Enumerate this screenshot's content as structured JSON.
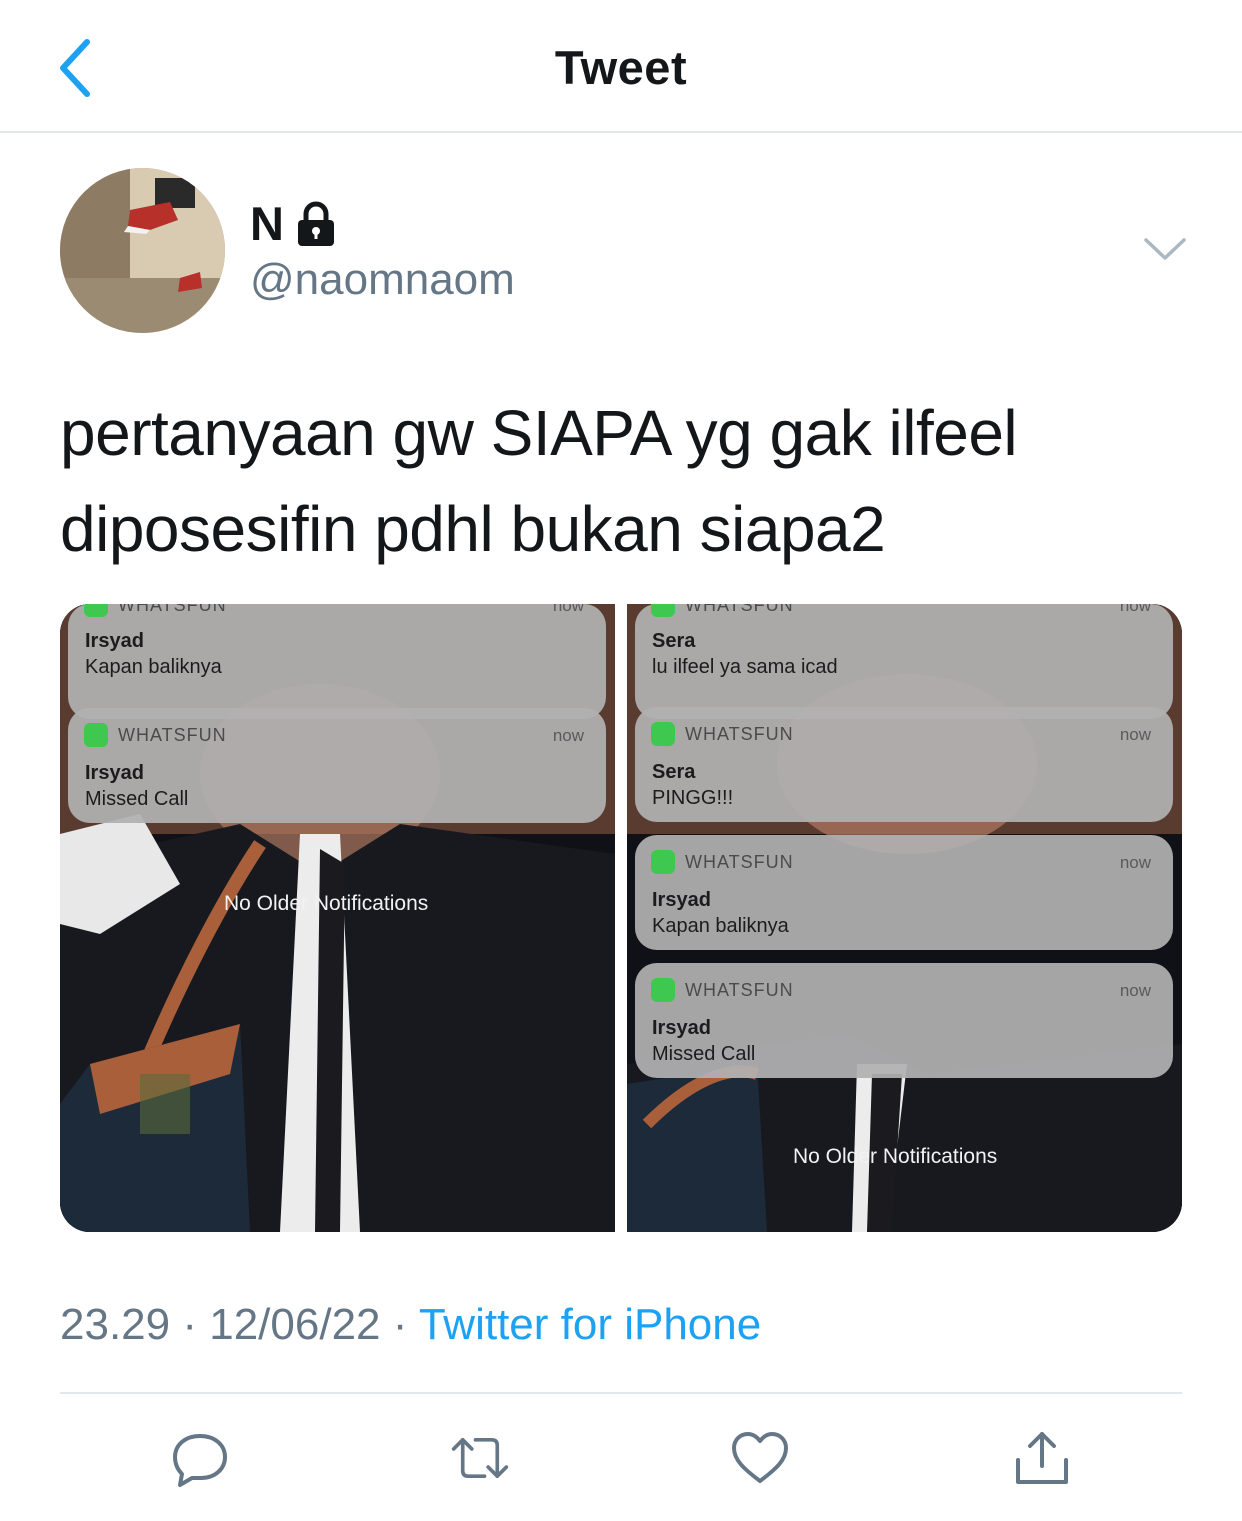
{
  "header": {
    "title": "Tweet"
  },
  "author": {
    "name": "N",
    "handle": "@naomnaom"
  },
  "tweet": {
    "text": "pertanyaan gw SIAPA yg gak ilfeel diposesifin pdhl bukan siapa2"
  },
  "media": {
    "left": {
      "notifications": [
        {
          "app": "WHATSFUN",
          "time": "now",
          "sender": "Irsyad",
          "message": "Kapan baliknya"
        },
        {
          "app": "WHATSFUN",
          "time": "now",
          "sender": "Irsyad",
          "message": "Missed Call"
        }
      ],
      "footer": "No Older Notifications"
    },
    "right": {
      "notifications": [
        {
          "app": "WHATSFUN",
          "time": "now",
          "sender": "Sera",
          "message": "lu ilfeel ya sama icad"
        },
        {
          "app": "WHATSFUN",
          "time": "now",
          "sender": "Sera",
          "message": "PINGG!!!"
        },
        {
          "app": "WHATSFUN",
          "time": "now",
          "sender": "Irsyad",
          "message": "Kapan baliknya"
        },
        {
          "app": "WHATSFUN",
          "time": "now",
          "sender": "Irsyad",
          "message": "Missed Call"
        }
      ],
      "footer": "No Older Notifications"
    }
  },
  "meta": {
    "time": "23.29",
    "date": "12/06/22",
    "separator": "·",
    "source": "Twitter for iPhone"
  },
  "icons": {
    "back": "chevron-left-icon",
    "lock": "lock-icon",
    "caret": "chevron-down-icon",
    "reply": "reply-icon",
    "retweet": "retweet-icon",
    "like": "heart-icon",
    "share": "share-icon"
  },
  "colors": {
    "accent": "#1da1f2",
    "secondary_text": "#657786",
    "divider": "#e1e8ed"
  }
}
